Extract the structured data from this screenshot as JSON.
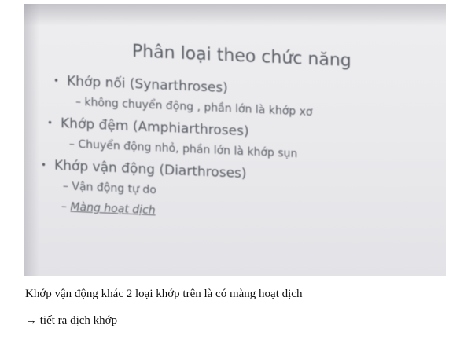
{
  "slide": {
    "title": "Phân loại theo chức năng",
    "items": [
      {
        "label": "Khớp nối (Synarthroses)",
        "sub": [
          "– không chuyển động , phần lớn là khớp xơ"
        ]
      },
      {
        "label": "Khớp đệm (Amphiarthroses)",
        "sub": [
          "– Chuyển động nhỏ, phần lớn là khớp sụn"
        ]
      },
      {
        "label": "Khớp vận động (Diarthroses)",
        "sub": [
          "– Vận động tự do",
          "Màng hoạt dịch"
        ]
      }
    ],
    "bullet_glyph": "•",
    "dash_glyph": "–"
  },
  "caption": {
    "line1": "Khớp vận động khác 2 loại khớp trên là có màng hoạt dịch",
    "line2": "→ tiết ra dịch khớp"
  }
}
